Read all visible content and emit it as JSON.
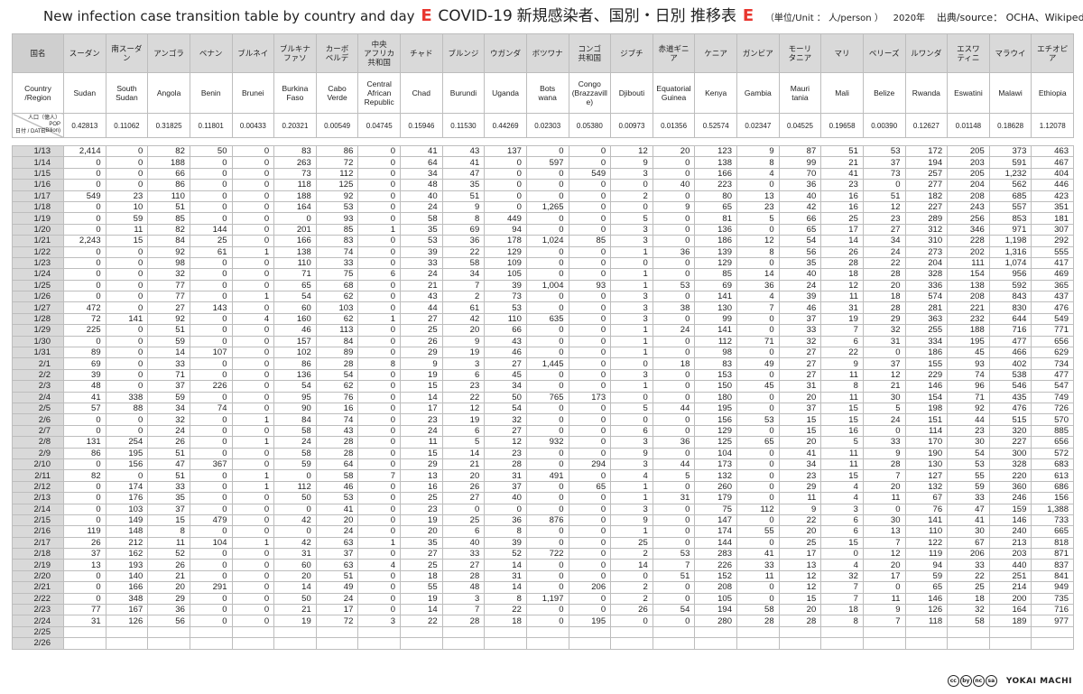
{
  "title": {
    "en": "New infection case transition table by country and day",
    "marker": "E",
    "main": "COVID-19",
    "jp": "新規感染者、国別・日別 推移表",
    "unit": "（単位/Unit ： 人/person ）",
    "year": "2020年",
    "source": "出典/source： OCHA、Wikipedia"
  },
  "header": {
    "jp_label": "国名",
    "en_label": "Country\n/Region",
    "pop_label_top": "人口（億人）\nPOP\n(Bilion)",
    "pop_label_bottom": "日付 / DATE"
  },
  "countries": [
    {
      "jp": "スーダン",
      "en": "Sudan",
      "pop": "0.42813"
    },
    {
      "jp": "南スーダン",
      "en": "South\nSudan",
      "pop": "0.11062"
    },
    {
      "jp": "アンゴラ",
      "en": "Angola",
      "pop": "0.31825"
    },
    {
      "jp": "ベナン",
      "en": "Benin",
      "pop": "0.11801"
    },
    {
      "jp": "ブルネイ",
      "en": "Brunei",
      "pop": "0.00433"
    },
    {
      "jp": "ブルキナ\nファソ",
      "en": "Burkina\nFaso",
      "pop": "0.20321"
    },
    {
      "jp": "カーボ\nベルデ",
      "en": "Cabo\nVerde",
      "pop": "0.00549"
    },
    {
      "jp": "中央\nアフリカ\n共和国",
      "en": "Central\nAfrican\nRepublic",
      "pop": "0.04745"
    },
    {
      "jp": "チャド",
      "en": "Chad",
      "pop": "0.15946"
    },
    {
      "jp": "ブルンジ",
      "en": "Burundi",
      "pop": "0.11530"
    },
    {
      "jp": "ウガンダ",
      "en": "Uganda",
      "pop": "0.44269"
    },
    {
      "jp": "ボツワナ",
      "en": "Bots\nwana",
      "pop": "0.02303"
    },
    {
      "jp": "コンゴ\n共和国",
      "en": "Congo\n(Brazzavill\ne)",
      "pop": "0.05380"
    },
    {
      "jp": "ジブチ",
      "en": "Djibouti",
      "pop": "0.00973"
    },
    {
      "jp": "赤道ギニア",
      "en": "Equatorial\nGuinea",
      "pop": "0.01356"
    },
    {
      "jp": "ケニア",
      "en": "Kenya",
      "pop": "0.52574"
    },
    {
      "jp": "ガンビア",
      "en": "Gambia",
      "pop": "0.02347"
    },
    {
      "jp": "モーリ\nタニア",
      "en": "Mauri\ntania",
      "pop": "0.04525"
    },
    {
      "jp": "マリ",
      "en": "Mali",
      "pop": "0.19658"
    },
    {
      "jp": "ベリーズ",
      "en": "Belize",
      "pop": "0.00390"
    },
    {
      "jp": "ルワンダ",
      "en": "Rwanda",
      "pop": "0.12627"
    },
    {
      "jp": "エスワ\nティニ",
      "en": "Eswatini",
      "pop": "0.01148"
    },
    {
      "jp": "マラウイ",
      "en": "Malawi",
      "pop": "0.18628"
    },
    {
      "jp": "エチオピア",
      "en": "Ethiopia",
      "pop": "1.12078"
    }
  ],
  "rows": [
    {
      "date": "1/13",
      "v": [
        "2,414",
        "0",
        "82",
        "50",
        "0",
        "83",
        "86",
        "0",
        "41",
        "43",
        "137",
        "0",
        "0",
        "12",
        "20",
        "123",
        "9",
        "87",
        "51",
        "53",
        "172",
        "205",
        "373",
        "463"
      ]
    },
    {
      "date": "1/14",
      "v": [
        "0",
        "0",
        "188",
        "0",
        "0",
        "263",
        "72",
        "0",
        "64",
        "41",
        "0",
        "597",
        "0",
        "9",
        "0",
        "138",
        "8",
        "99",
        "21",
        "37",
        "194",
        "203",
        "591",
        "467"
      ]
    },
    {
      "date": "1/15",
      "v": [
        "0",
        "0",
        "66",
        "0",
        "0",
        "73",
        "112",
        "0",
        "34",
        "47",
        "0",
        "0",
        "549",
        "3",
        "0",
        "166",
        "4",
        "70",
        "41",
        "73",
        "257",
        "205",
        "1,232",
        "404"
      ]
    },
    {
      "date": "1/16",
      "v": [
        "0",
        "0",
        "86",
        "0",
        "0",
        "118",
        "125",
        "0",
        "48",
        "35",
        "0",
        "0",
        "0",
        "0",
        "40",
        "223",
        "0",
        "36",
        "23",
        "0",
        "277",
        "204",
        "562",
        "446"
      ]
    },
    {
      "date": "1/17",
      "v": [
        "549",
        "23",
        "110",
        "0",
        "0",
        "188",
        "92",
        "0",
        "40",
        "51",
        "0",
        "0",
        "0",
        "2",
        "0",
        "80",
        "13",
        "40",
        "16",
        "51",
        "182",
        "208",
        "685",
        "423"
      ]
    },
    {
      "date": "1/18",
      "v": [
        "0",
        "10",
        "51",
        "0",
        "0",
        "164",
        "53",
        "0",
        "24",
        "9",
        "0",
        "1,265",
        "0",
        "0",
        "9",
        "65",
        "23",
        "42",
        "16",
        "12",
        "227",
        "243",
        "557",
        "351"
      ]
    },
    {
      "date": "1/19",
      "v": [
        "0",
        "59",
        "85",
        "0",
        "0",
        "0",
        "93",
        "0",
        "58",
        "8",
        "449",
        "0",
        "0",
        "5",
        "0",
        "81",
        "5",
        "66",
        "25",
        "23",
        "289",
        "256",
        "853",
        "181"
      ]
    },
    {
      "date": "1/20",
      "v": [
        "0",
        "11",
        "82",
        "144",
        "0",
        "201",
        "85",
        "1",
        "35",
        "69",
        "94",
        "0",
        "0",
        "3",
        "0",
        "136",
        "0",
        "65",
        "17",
        "27",
        "312",
        "346",
        "971",
        "307"
      ]
    },
    {
      "date": "1/21",
      "v": [
        "2,243",
        "15",
        "84",
        "25",
        "0",
        "166",
        "83",
        "0",
        "53",
        "36",
        "178",
        "1,024",
        "85",
        "3",
        "0",
        "186",
        "12",
        "54",
        "14",
        "34",
        "310",
        "228",
        "1,198",
        "292"
      ]
    },
    {
      "date": "1/22",
      "v": [
        "0",
        "0",
        "92",
        "61",
        "1",
        "138",
        "74",
        "0",
        "39",
        "22",
        "129",
        "0",
        "0",
        "1",
        "36",
        "139",
        "8",
        "56",
        "26",
        "24",
        "273",
        "202",
        "1,316",
        "555"
      ]
    },
    {
      "date": "1/23",
      "v": [
        "0",
        "0",
        "98",
        "0",
        "0",
        "110",
        "33",
        "0",
        "33",
        "58",
        "109",
        "0",
        "0",
        "0",
        "0",
        "129",
        "0",
        "35",
        "28",
        "22",
        "204",
        "111",
        "1,074",
        "417"
      ]
    },
    {
      "date": "1/24",
      "v": [
        "0",
        "0",
        "32",
        "0",
        "0",
        "71",
        "75",
        "6",
        "24",
        "34",
        "105",
        "0",
        "0",
        "1",
        "0",
        "85",
        "14",
        "40",
        "18",
        "28",
        "328",
        "154",
        "956",
        "469"
      ]
    },
    {
      "date": "1/25",
      "v": [
        "0",
        "0",
        "77",
        "0",
        "0",
        "65",
        "68",
        "0",
        "21",
        "7",
        "39",
        "1,004",
        "93",
        "1",
        "53",
        "69",
        "36",
        "24",
        "12",
        "20",
        "336",
        "138",
        "592",
        "365"
      ]
    },
    {
      "date": "1/26",
      "v": [
        "0",
        "0",
        "77",
        "0",
        "1",
        "54",
        "62",
        "0",
        "43",
        "2",
        "73",
        "0",
        "0",
        "3",
        "0",
        "141",
        "4",
        "39",
        "11",
        "18",
        "574",
        "208",
        "843",
        "437"
      ]
    },
    {
      "date": "1/27",
      "v": [
        "472",
        "0",
        "27",
        "143",
        "0",
        "60",
        "103",
        "0",
        "44",
        "61",
        "53",
        "0",
        "0",
        "3",
        "38",
        "130",
        "7",
        "46",
        "31",
        "28",
        "281",
        "221",
        "830",
        "476"
      ]
    },
    {
      "date": "1/28",
      "v": [
        "72",
        "141",
        "92",
        "0",
        "4",
        "160",
        "62",
        "1",
        "27",
        "42",
        "110",
        "635",
        "0",
        "3",
        "0",
        "99",
        "0",
        "37",
        "19",
        "29",
        "363",
        "232",
        "644",
        "549"
      ]
    },
    {
      "date": "1/29",
      "v": [
        "225",
        "0",
        "51",
        "0",
        "0",
        "46",
        "113",
        "0",
        "25",
        "20",
        "66",
        "0",
        "0",
        "1",
        "24",
        "141",
        "0",
        "33",
        "7",
        "32",
        "255",
        "188",
        "716",
        "771"
      ]
    },
    {
      "date": "1/30",
      "v": [
        "0",
        "0",
        "59",
        "0",
        "0",
        "157",
        "84",
        "0",
        "26",
        "9",
        "43",
        "0",
        "0",
        "1",
        "0",
        "112",
        "71",
        "32",
        "6",
        "31",
        "334",
        "195",
        "477",
        "656"
      ]
    },
    {
      "date": "1/31",
      "v": [
        "89",
        "0",
        "14",
        "107",
        "0",
        "102",
        "89",
        "0",
        "29",
        "19",
        "46",
        "0",
        "0",
        "1",
        "0",
        "98",
        "0",
        "27",
        "22",
        "0",
        "186",
        "45",
        "466",
        "629"
      ]
    },
    {
      "date": "2/1",
      "v": [
        "69",
        "0",
        "33",
        "0",
        "0",
        "86",
        "28",
        "8",
        "9",
        "3",
        "27",
        "1,445",
        "0",
        "0",
        "18",
        "83",
        "49",
        "27",
        "9",
        "37",
        "155",
        "93",
        "402",
        "734"
      ]
    },
    {
      "date": "2/2",
      "v": [
        "39",
        "0",
        "71",
        "0",
        "0",
        "136",
        "54",
        "0",
        "19",
        "6",
        "45",
        "0",
        "0",
        "3",
        "0",
        "153",
        "0",
        "27",
        "11",
        "12",
        "229",
        "74",
        "538",
        "477"
      ]
    },
    {
      "date": "2/3",
      "v": [
        "48",
        "0",
        "37",
        "226",
        "0",
        "54",
        "62",
        "0",
        "15",
        "23",
        "34",
        "0",
        "0",
        "1",
        "0",
        "150",
        "45",
        "31",
        "8",
        "21",
        "146",
        "96",
        "546",
        "547"
      ]
    },
    {
      "date": "2/4",
      "v": [
        "41",
        "338",
        "59",
        "0",
        "0",
        "95",
        "76",
        "0",
        "14",
        "22",
        "50",
        "765",
        "173",
        "0",
        "0",
        "180",
        "0",
        "20",
        "11",
        "30",
        "154",
        "71",
        "435",
        "749"
      ]
    },
    {
      "date": "2/5",
      "v": [
        "57",
        "88",
        "34",
        "74",
        "0",
        "90",
        "16",
        "0",
        "17",
        "12",
        "54",
        "0",
        "0",
        "5",
        "44",
        "195",
        "0",
        "37",
        "15",
        "5",
        "198",
        "92",
        "476",
        "726"
      ]
    },
    {
      "date": "2/6",
      "v": [
        "0",
        "0",
        "32",
        "0",
        "1",
        "84",
        "74",
        "0",
        "23",
        "19",
        "32",
        "0",
        "0",
        "0",
        "0",
        "156",
        "53",
        "15",
        "15",
        "24",
        "151",
        "44",
        "515",
        "570"
      ]
    },
    {
      "date": "2/7",
      "v": [
        "0",
        "0",
        "24",
        "0",
        "0",
        "58",
        "43",
        "0",
        "24",
        "6",
        "27",
        "0",
        "0",
        "6",
        "0",
        "129",
        "0",
        "15",
        "16",
        "0",
        "114",
        "23",
        "320",
        "885"
      ]
    },
    {
      "date": "2/8",
      "v": [
        "131",
        "254",
        "26",
        "0",
        "1",
        "24",
        "28",
        "0",
        "11",
        "5",
        "12",
        "932",
        "0",
        "3",
        "36",
        "125",
        "65",
        "20",
        "5",
        "33",
        "170",
        "30",
        "227",
        "656"
      ]
    },
    {
      "date": "2/9",
      "v": [
        "86",
        "195",
        "51",
        "0",
        "0",
        "58",
        "28",
        "0",
        "15",
        "14",
        "23",
        "0",
        "0",
        "9",
        "0",
        "104",
        "0",
        "41",
        "11",
        "9",
        "190",
        "54",
        "300",
        "572"
      ]
    },
    {
      "date": "2/10",
      "v": [
        "0",
        "156",
        "47",
        "367",
        "0",
        "59",
        "64",
        "0",
        "29",
        "21",
        "28",
        "0",
        "294",
        "3",
        "44",
        "173",
        "0",
        "34",
        "11",
        "28",
        "130",
        "53",
        "328",
        "683"
      ]
    },
    {
      "date": "2/11",
      "v": [
        "82",
        "0",
        "51",
        "0",
        "1",
        "0",
        "58",
        "7",
        "13",
        "20",
        "31",
        "491",
        "0",
        "4",
        "5",
        "132",
        "0",
        "23",
        "15",
        "7",
        "127",
        "55",
        "220",
        "613"
      ]
    },
    {
      "date": "2/12",
      "v": [
        "0",
        "174",
        "33",
        "0",
        "1",
        "112",
        "46",
        "0",
        "16",
        "26",
        "37",
        "0",
        "65",
        "1",
        "0",
        "260",
        "0",
        "29",
        "4",
        "20",
        "132",
        "59",
        "360",
        "686"
      ]
    },
    {
      "date": "2/13",
      "v": [
        "0",
        "176",
        "35",
        "0",
        "0",
        "50",
        "53",
        "0",
        "25",
        "27",
        "40",
        "0",
        "0",
        "1",
        "31",
        "179",
        "0",
        "11",
        "4",
        "11",
        "67",
        "33",
        "246",
        "156"
      ]
    },
    {
      "date": "2/14",
      "v": [
        "0",
        "103",
        "37",
        "0",
        "0",
        "0",
        "41",
        "0",
        "23",
        "0",
        "0",
        "0",
        "0",
        "3",
        "0",
        "75",
        "112",
        "9",
        "3",
        "0",
        "76",
        "47",
        "159",
        "1,388"
      ]
    },
    {
      "date": "2/15",
      "v": [
        "0",
        "149",
        "15",
        "479",
        "0",
        "42",
        "20",
        "0",
        "19",
        "25",
        "36",
        "876",
        "0",
        "9",
        "0",
        "147",
        "0",
        "22",
        "6",
        "30",
        "141",
        "41",
        "146",
        "733"
      ]
    },
    {
      "date": "2/16",
      "v": [
        "119",
        "148",
        "8",
        "0",
        "0",
        "0",
        "24",
        "0",
        "20",
        "6",
        "8",
        "0",
        "0",
        "1",
        "0",
        "174",
        "55",
        "20",
        "6",
        "13",
        "110",
        "30",
        "240",
        "665"
      ]
    },
    {
      "date": "2/17",
      "v": [
        "26",
        "212",
        "11",
        "104",
        "1",
        "42",
        "63",
        "1",
        "35",
        "40",
        "39",
        "0",
        "0",
        "25",
        "0",
        "144",
        "0",
        "25",
        "15",
        "7",
        "122",
        "67",
        "213",
        "818"
      ]
    },
    {
      "date": "2/18",
      "v": [
        "37",
        "162",
        "52",
        "0",
        "0",
        "31",
        "37",
        "0",
        "27",
        "33",
        "52",
        "722",
        "0",
        "2",
        "53",
        "283",
        "41",
        "17",
        "0",
        "12",
        "119",
        "206",
        "203",
        "871"
      ]
    },
    {
      "date": "2/19",
      "v": [
        "13",
        "193",
        "26",
        "0",
        "0",
        "60",
        "63",
        "4",
        "25",
        "27",
        "14",
        "0",
        "0",
        "14",
        "7",
        "226",
        "33",
        "13",
        "4",
        "20",
        "94",
        "33",
        "440",
        "837"
      ]
    },
    {
      "date": "2/20",
      "v": [
        "0",
        "140",
        "21",
        "0",
        "0",
        "20",
        "51",
        "0",
        "18",
        "28",
        "31",
        "0",
        "0",
        "0",
        "51",
        "152",
        "11",
        "12",
        "32",
        "17",
        "59",
        "22",
        "251",
        "841"
      ]
    },
    {
      "date": "2/21",
      "v": [
        "0",
        "166",
        "20",
        "291",
        "0",
        "14",
        "49",
        "0",
        "55",
        "48",
        "14",
        "0",
        "206",
        "2",
        "0",
        "208",
        "0",
        "12",
        "7",
        "0",
        "65",
        "25",
        "214",
        "949"
      ]
    },
    {
      "date": "2/22",
      "v": [
        "0",
        "348",
        "29",
        "0",
        "0",
        "50",
        "24",
        "0",
        "19",
        "3",
        "8",
        "1,197",
        "0",
        "2",
        "0",
        "105",
        "0",
        "15",
        "7",
        "11",
        "146",
        "18",
        "200",
        "735"
      ]
    },
    {
      "date": "2/23",
      "v": [
        "77",
        "167",
        "36",
        "0",
        "0",
        "21",
        "17",
        "0",
        "14",
        "7",
        "22",
        "0",
        "0",
        "26",
        "54",
        "194",
        "58",
        "20",
        "18",
        "9",
        "126",
        "32",
        "164",
        "716"
      ]
    },
    {
      "date": "2/24",
      "v": [
        "31",
        "126",
        "56",
        "0",
        "0",
        "19",
        "72",
        "3",
        "22",
        "28",
        "18",
        "0",
        "195",
        "0",
        "0",
        "280",
        "28",
        "28",
        "8",
        "7",
        "118",
        "58",
        "189",
        "977"
      ]
    },
    {
      "date": "2/25",
      "v": [
        "",
        "",
        "",
        "",
        "",
        "",
        "",
        "",
        "",
        "",
        "",
        "",
        "",
        "",
        "",
        "",
        "",
        "",
        "",
        "",
        "",
        "",
        "",
        ""
      ]
    },
    {
      "date": "2/26",
      "v": [
        "",
        "",
        "",
        "",
        "",
        "",
        "",
        "",
        "",
        "",
        "",
        "",
        "",
        "",
        "",
        "",
        "",
        "",
        "",
        "",
        "",
        "",
        "",
        ""
      ]
    }
  ],
  "footer": {
    "license": [
      "cc",
      "by",
      "nc",
      "sa"
    ],
    "brand": "YOKAI MACHI"
  }
}
